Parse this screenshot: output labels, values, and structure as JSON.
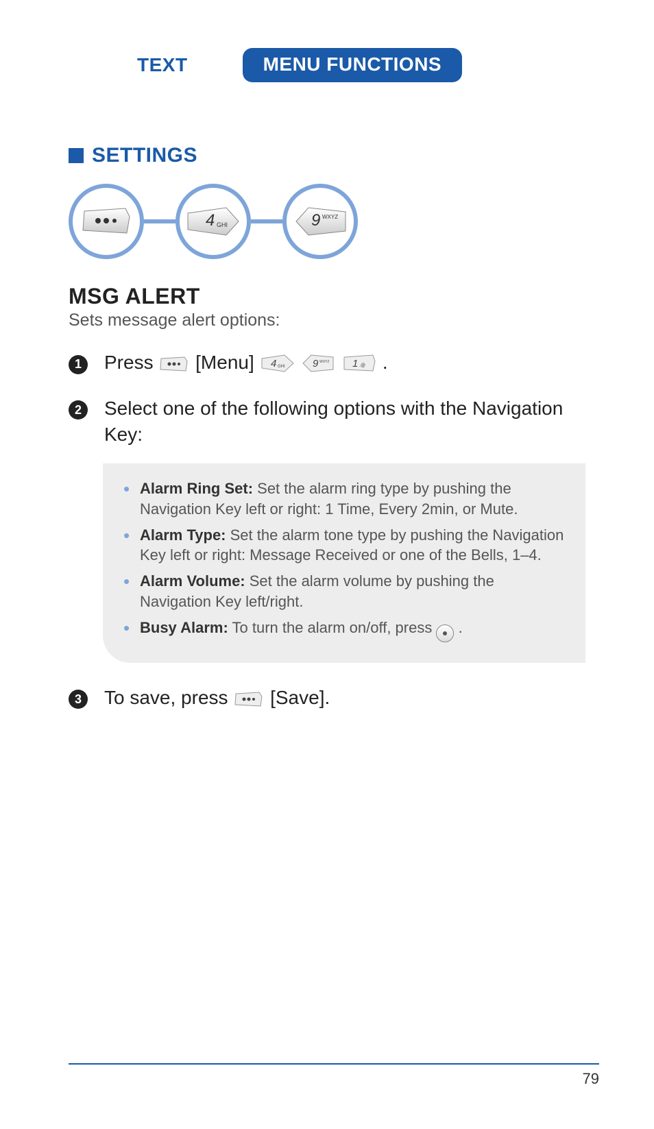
{
  "header": {
    "tab_left": "TEXT",
    "tab_right": "MENU FUNCTIONS"
  },
  "section": {
    "title": "SETTINGS"
  },
  "key_sequence_large": {
    "key1_icon": "menu-dots-key",
    "key2_digit": "4",
    "key2_letters": "GHI",
    "key3_digit": "9",
    "key3_letters": "WXYZ"
  },
  "msg_alert": {
    "title": "MSG ALERT",
    "description": "Sets message alert options:"
  },
  "steps": {
    "s1_num": "1",
    "s1_text_prefix": "Press ",
    "s1_menu_label": " [Menu] ",
    "s1_key4": "4",
    "s1_key4_sub": "GHI",
    "s1_key9": "9",
    "s1_key9_sub": "WXYZ",
    "s1_key1": "1",
    "s1_key1_sub": ".@",
    "s1_period": " .",
    "s2_num": "2",
    "s2_text": "Select one of the following options with the Navigation Key:",
    "s3_num": "3",
    "s3_text_prefix": "To save, press ",
    "s3_save_label": " [Save]."
  },
  "options": [
    {
      "label": "Alarm Ring Set:",
      "desc": " Set the alarm ring type by pushing the Navigation Key left or right: 1 Time, Every 2min, or Mute."
    },
    {
      "label": "Alarm Type:",
      "desc": " Set the alarm tone type by pushing the Navigation Key left or right: Message Received or one of the Bells, 1–4."
    },
    {
      "label": "Alarm Volume:",
      "desc": " Set the alarm volume by pushing the Navigation Key left/right."
    },
    {
      "label": "Busy Alarm:",
      "desc": " To turn the alarm on/off, press ",
      "has_icon": true,
      "suffix": " ."
    }
  ],
  "footer": {
    "page": "79"
  }
}
